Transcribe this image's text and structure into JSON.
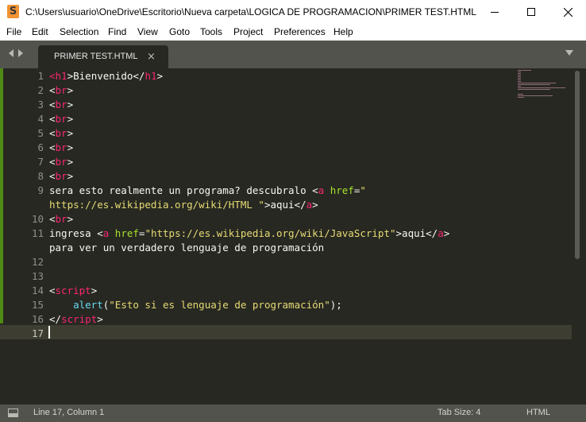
{
  "window": {
    "title": "C:\\Users\\usuario\\OneDrive\\Escritorio\\Nueva carpeta\\LOGICA DE PROGRAMACION\\PRIMER TEST.HTML -...",
    "app_icon": "S"
  },
  "menu": [
    "File",
    "Edit",
    "Selection",
    "Find",
    "View",
    "Goto",
    "Tools",
    "Project",
    "Preferences",
    "Help"
  ],
  "tab": {
    "label": "PRIMER TEST.HTML",
    "close": "×"
  },
  "gutter": [
    "1",
    "2",
    "3",
    "4",
    "5",
    "6",
    "7",
    "8",
    "9",
    "",
    "10",
    "11",
    "",
    "12",
    "13",
    "14",
    "15",
    "16",
    "17"
  ],
  "code": [
    [
      [
        "tag",
        "<"
      ],
      [
        "tag",
        "h1"
      ],
      [
        "plain",
        ">Bienvenido</"
      ],
      [
        "tag",
        "h1"
      ],
      [
        "plain",
        ">"
      ]
    ],
    [
      [
        "plain",
        "<"
      ],
      [
        "tag",
        "br"
      ],
      [
        "plain",
        ">"
      ]
    ],
    [
      [
        "plain",
        "<"
      ],
      [
        "tag",
        "br"
      ],
      [
        "plain",
        ">"
      ]
    ],
    [
      [
        "plain",
        "<"
      ],
      [
        "tag",
        "br"
      ],
      [
        "plain",
        ">"
      ]
    ],
    [
      [
        "plain",
        "<"
      ],
      [
        "tag",
        "br"
      ],
      [
        "plain",
        ">"
      ]
    ],
    [
      [
        "plain",
        "<"
      ],
      [
        "tag",
        "br"
      ],
      [
        "plain",
        ">"
      ]
    ],
    [
      [
        "plain",
        "<"
      ],
      [
        "tag",
        "br"
      ],
      [
        "plain",
        ">"
      ]
    ],
    [
      [
        "plain",
        "<"
      ],
      [
        "tag",
        "br"
      ],
      [
        "plain",
        ">"
      ]
    ],
    [
      [
        "plain",
        "sera esto realmente un programa? descubralo <"
      ],
      [
        "tag",
        "a"
      ],
      [
        "plain",
        " "
      ],
      [
        "attr",
        "href"
      ],
      [
        "plain",
        "="
      ],
      [
        "str",
        "\""
      ]
    ],
    [
      [
        "str",
        "https://es.wikipedia.org/wiki/HTML \""
      ],
      [
        "plain",
        ">aqui</"
      ],
      [
        "tag",
        "a"
      ],
      [
        "plain",
        ">"
      ]
    ],
    [
      [
        "plain",
        "<"
      ],
      [
        "tag",
        "br"
      ],
      [
        "plain",
        ">"
      ]
    ],
    [
      [
        "plain",
        "ingresa <"
      ],
      [
        "tag",
        "a"
      ],
      [
        "plain",
        " "
      ],
      [
        "attr",
        "href"
      ],
      [
        "plain",
        "="
      ],
      [
        "str",
        "\"https://es.wikipedia.org/wiki/JavaScript\""
      ],
      [
        "plain",
        ">aqui</"
      ],
      [
        "tag",
        "a"
      ],
      [
        "plain",
        ">"
      ]
    ],
    [
      [
        "plain",
        "para ver un verdadero lenguaje de programación"
      ]
    ],
    [],
    [],
    [
      [
        "plain",
        "<"
      ],
      [
        "tag",
        "script"
      ],
      [
        "plain",
        ">"
      ]
    ],
    [
      [
        "plain",
        "    "
      ],
      [
        "fn",
        "alert"
      ],
      [
        "plain",
        "("
      ],
      [
        "str",
        "\"Esto si es lenguaje de programación\""
      ],
      [
        "plain",
        ");"
      ]
    ],
    [
      [
        "plain",
        "</"
      ],
      [
        "tag",
        "script"
      ],
      [
        "plain",
        ">"
      ]
    ],
    []
  ],
  "status": {
    "position": "Line 17, Column 1",
    "tab_size": "Tab Size: 4",
    "syntax": "HTML"
  },
  "colors": {
    "background": "#272822",
    "tag": "#f92672",
    "attribute": "#a6e22e",
    "string": "#e6db74",
    "function": "#66d9ef",
    "text": "#f8f8f2"
  }
}
